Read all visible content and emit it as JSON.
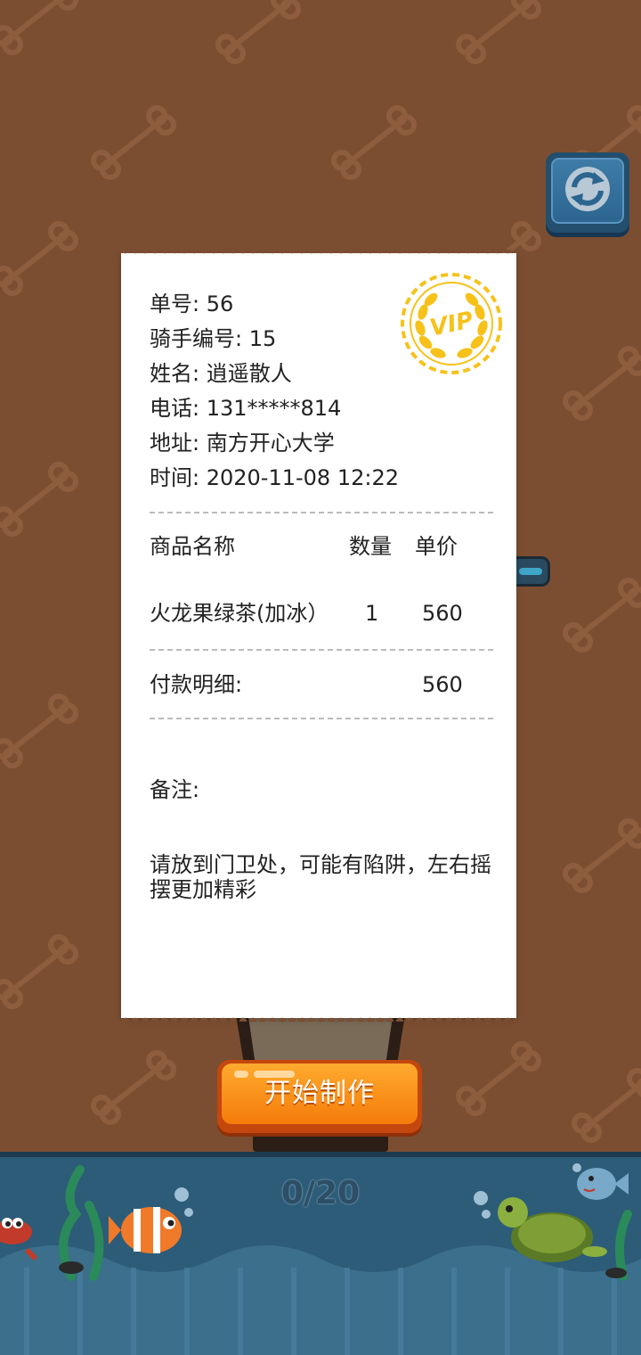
{
  "receipt": {
    "order_no": "单号: 56",
    "rider_no": "骑手编号: 15",
    "name": "姓名: 逍遥散人",
    "phone": "电话: 131*****814",
    "address": "地址: 南方开心大学",
    "time": "时间: 2020-11-08 12:22",
    "badge": "VIP",
    "headers": {
      "item": "商品名称",
      "qty": "数量",
      "price": "单价"
    },
    "items": [
      {
        "name": "火龙果绿茶(加冰）",
        "qty": "1",
        "price": "560"
      }
    ],
    "payment_label": "付款明细:",
    "payment_total": "560",
    "note_label": "备注:",
    "note_text": "请放到门卫处，可能有陷阱，左右摇摆更加精彩"
  },
  "start_button": {
    "label": "开始制作"
  },
  "progress": {
    "text": "0/20",
    "done": 0,
    "total": 20
  },
  "icons": {
    "refresh": "refresh-icon"
  },
  "colors": {
    "background": "#7c4e31",
    "button": "#f47c0a",
    "badge": "#f6c21a",
    "water": "#2d5c78"
  }
}
